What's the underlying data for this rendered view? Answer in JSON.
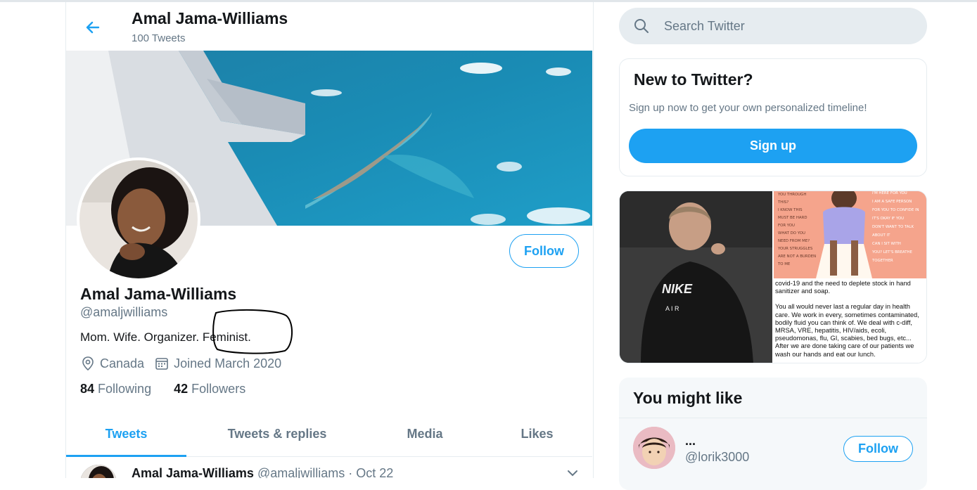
{
  "header": {
    "name": "Amal Jama-Williams",
    "tweet_count": "100 Tweets"
  },
  "profile": {
    "name": "Amal Jama-Williams",
    "handle": "@amaljwilliams",
    "bio_prefix": "Mom. Wife. Organizer.",
    "bio_highlight": "Feminist.",
    "location": "Canada",
    "joined": "Joined March 2020",
    "following_count": "84",
    "following_label": "Following",
    "followers_count": "42",
    "followers_label": "Followers",
    "follow_label": "Follow"
  },
  "tabs": [
    {
      "label": "Tweets",
      "active": true
    },
    {
      "label": "Tweets & replies",
      "active": false
    },
    {
      "label": "Media",
      "active": false
    },
    {
      "label": "Likes",
      "active": false
    }
  ],
  "tweet": {
    "name": "Amal Jama-Williams",
    "meta": "@amaljwilliams · Oct 22"
  },
  "search": {
    "placeholder": "Search Twitter"
  },
  "new_to_twitter": {
    "title": "New to Twitter?",
    "subtitle": "Sign up now to get your own personalized timeline!",
    "button": "Sign up"
  },
  "media": {
    "left_shirt_text": "NIKE",
    "left_shirt_subtext": "A I R",
    "art_lines_left": [
      "YOU THROUGH",
      "THIS?",
      "I KNOW THIS",
      "MUST BE HARD",
      "FOR YOU",
      "WHAT DO YOU",
      "NEED FROM ME?",
      "YOUR STRUGGLES",
      "ARE NOT A BURDEN",
      "TO ME"
    ],
    "art_lines_right": [
      "I'M HERE FOR YOU",
      "I AM A SAFE PERSON",
      "FOR YOU TO CONFIDE IN",
      "IT'S OKAY IF YOU",
      "DON'T WANT TO TALK",
      "ABOUT IT",
      "CAN I SIT WITH",
      "YOU? LET'S BREATHE",
      "TOGETHER"
    ],
    "text_1": "covid-19 and the need to deplete stock in hand sanitizer and soap.",
    "text_2": "You all would never last a regular day in health care. We work in every, sometimes contaminated, bodily fluid you can think of. We deal with c-diff, MRSA, VRE, hepatitis, HIV/aids, ecoli, pseudomonas, flu, GI, scabies, bed bugs, etc... After we are done taking care of our patients we wash our hands and eat our lunch."
  },
  "you_might_like": {
    "title": "You might like",
    "user_name": "...",
    "user_handle": "@lorik3000",
    "follow_label": "Follow"
  },
  "colors": {
    "accent": "#1da1f2",
    "muted": "#657786",
    "text": "#14171a",
    "border": "#e6ecf0"
  }
}
